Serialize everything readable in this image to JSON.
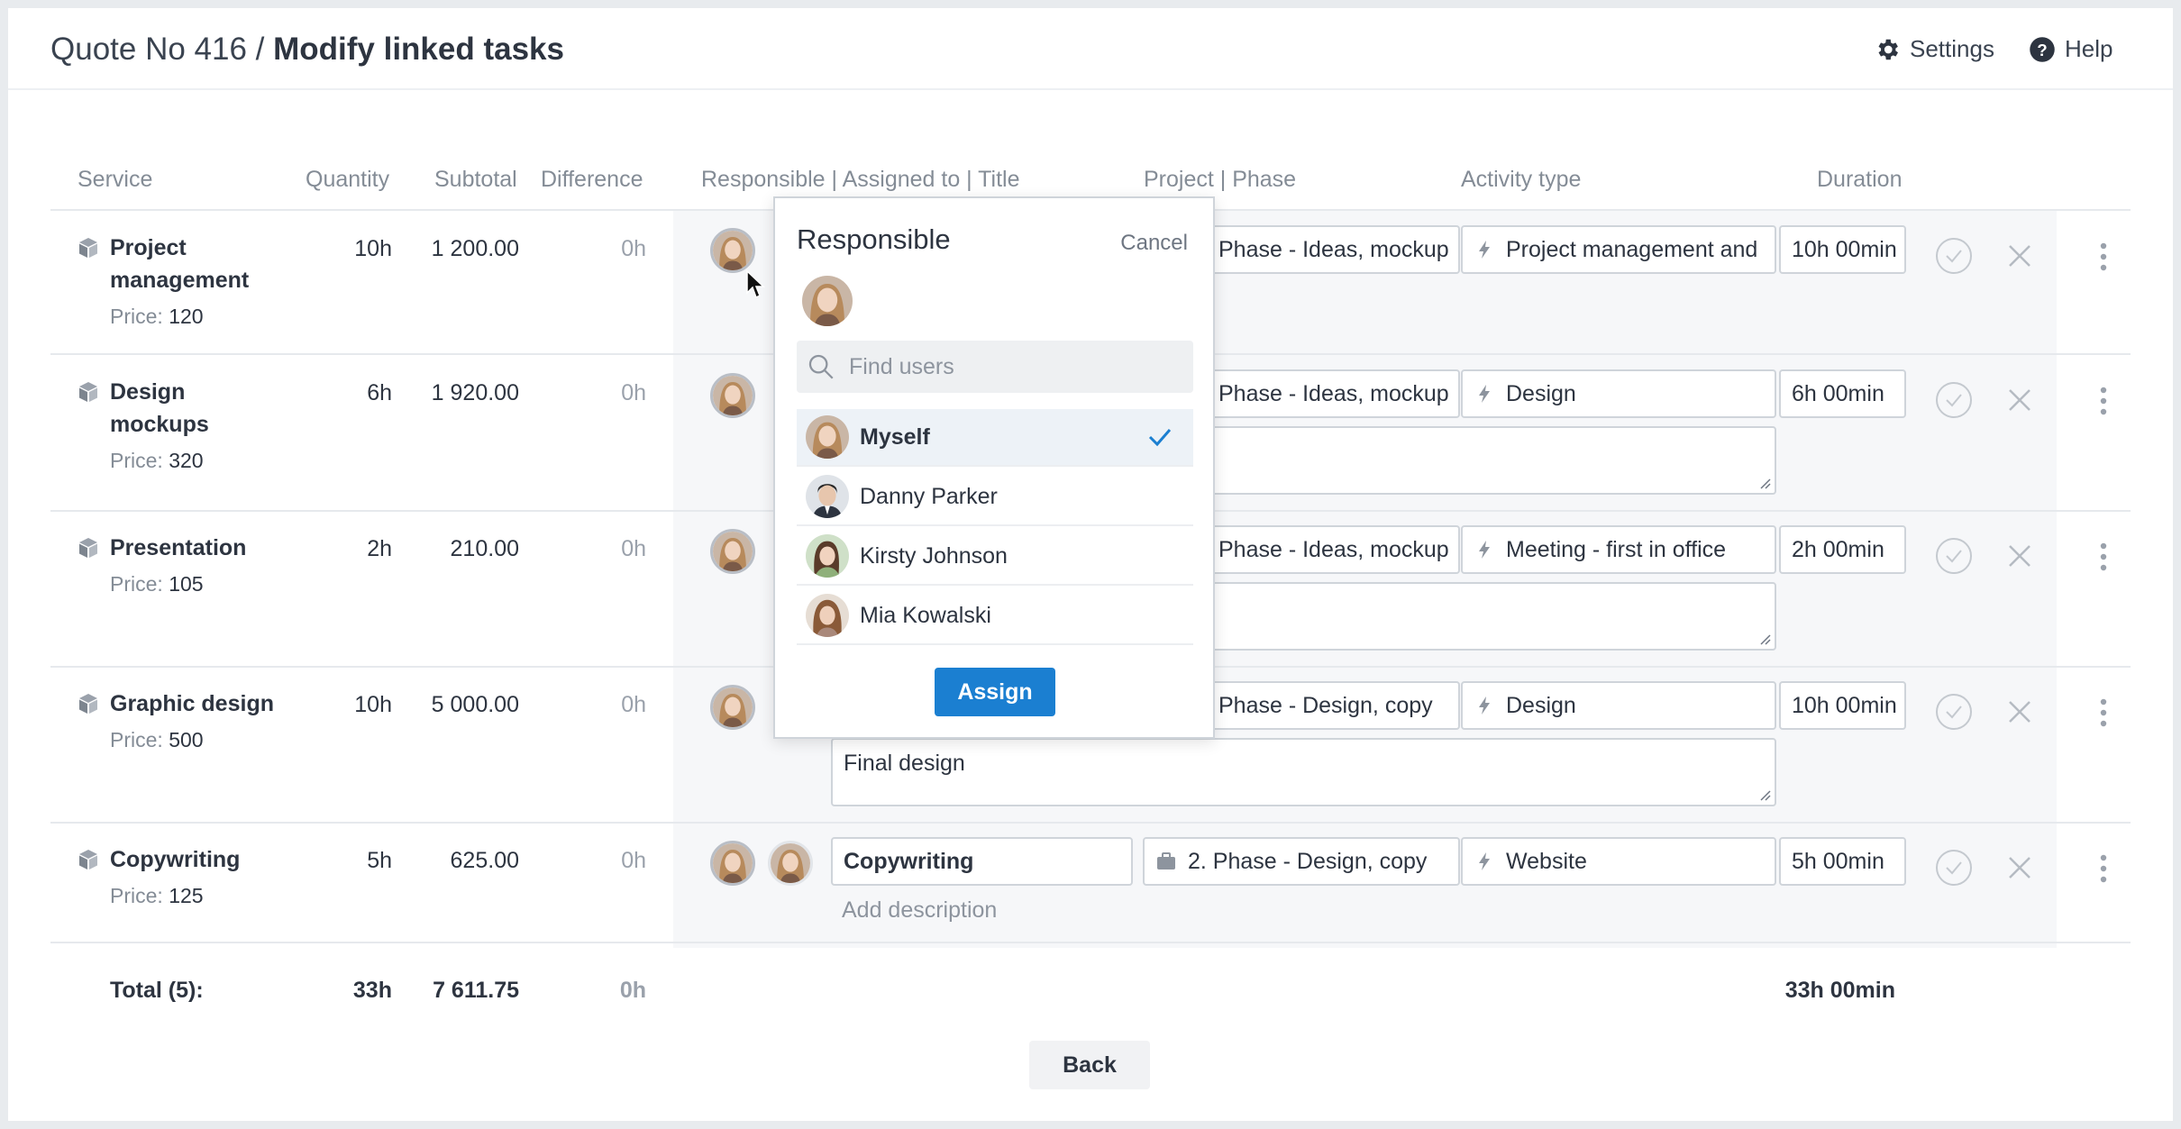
{
  "header": {
    "title_prefix": "Quote No 416 / ",
    "title_strong": "Modify linked tasks",
    "settings_label": "Settings",
    "help_label": "Help"
  },
  "columns": {
    "service": "Service",
    "quantity": "Quantity",
    "subtotal": "Subtotal",
    "difference": "Difference",
    "responsible": "Responsible | Assigned to | Title",
    "project": "Project | Phase",
    "activity": "Activity type",
    "duration": "Duration"
  },
  "price_label": "Price:",
  "rows": [
    {
      "name1": "Project",
      "name2": "management",
      "price": "120",
      "quantity": "10h",
      "subtotal": "1 200.00",
      "difference": "0h",
      "phase": "Phase - Ideas, mockup",
      "activity": "Project management and",
      "duration": "10h 00min"
    },
    {
      "name1": "Design",
      "name2": "mockups",
      "price": "320",
      "quantity": "6h",
      "subtotal": "1 920.00",
      "difference": "0h",
      "phase": "Phase - Ideas, mockup",
      "activity": "Design",
      "duration": "6h 00min"
    },
    {
      "name1": "Presentation",
      "name2": "",
      "price": "105",
      "quantity": "2h",
      "subtotal": "210.00",
      "difference": "0h",
      "phase": "Phase - Ideas, mockup",
      "activity": "Meeting - first in office",
      "duration": "2h 00min"
    },
    {
      "name1": "Graphic design",
      "name2": "",
      "price": "500",
      "quantity": "10h",
      "subtotal": "5 000.00",
      "difference": "0h",
      "phase": "Phase - Design, copy",
      "activity": "Design",
      "duration": "10h 00min",
      "description": "Final design"
    },
    {
      "name1": "Copywriting",
      "name2": "",
      "price": "125",
      "quantity": "5h",
      "subtotal": "625.00",
      "difference": "0h",
      "title": "Copywriting",
      "phase": "2. Phase - Design, copy",
      "activity": "Website",
      "duration": "5h 00min",
      "description_placeholder": "Add description"
    }
  ],
  "totals": {
    "label": "Total (5):",
    "quantity": "33h",
    "subtotal": "7 611.75",
    "difference": "0h",
    "duration": "33h 00min"
  },
  "popup": {
    "title": "Responsible",
    "cancel_label": "Cancel",
    "search_placeholder": "Find users",
    "users": [
      "Myself",
      "Danny Parker",
      "Kirsty Johnson",
      "Mia Kowalski"
    ],
    "selected_user": "Myself",
    "assign_label": "Assign"
  },
  "back_label": "Back",
  "colors": {
    "accent": "#1b7fd1",
    "band": "#f6f7f9",
    "muted": "#848c96"
  }
}
